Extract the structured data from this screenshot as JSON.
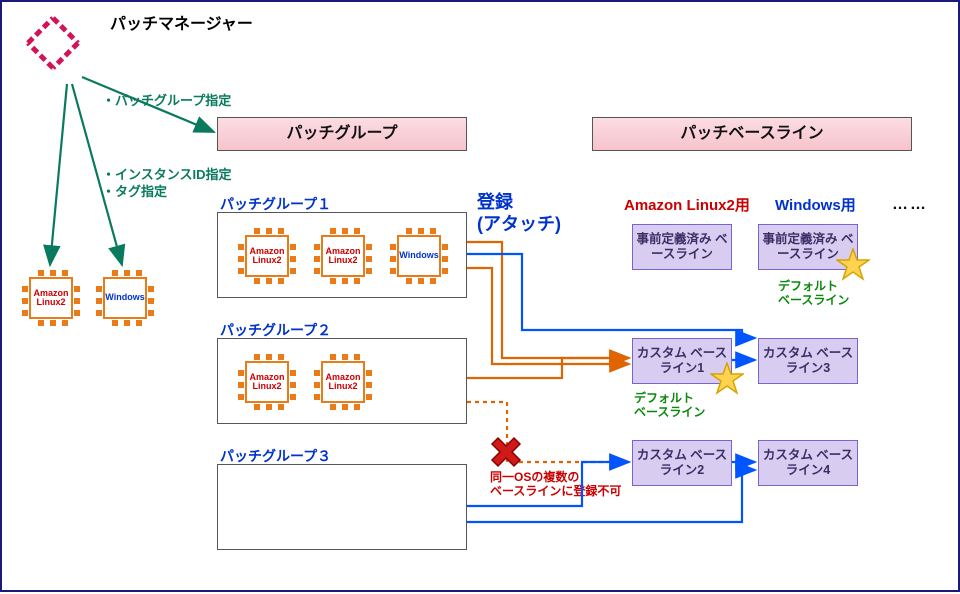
{
  "title": "パッチマネージャー",
  "notes": {
    "patch_group_spec": "・パッチグループ指定",
    "instance_id_spec": "・インスタンスID指定",
    "tag_spec": "・タグ指定",
    "register_attach": "登録\n(アタッチ)",
    "warn_multi_register": "同一OSの複数の\nベースラインに登録不可",
    "default_baseline_1": "デフォルト\nベースライン",
    "default_baseline_2": "デフォルト\nベースライン"
  },
  "headers": {
    "patch_group": "パッチグループ",
    "patch_baseline": "パッチベースライン"
  },
  "columns": {
    "col1": "Amazon Linux2用",
    "col2": "Windows用",
    "more": "……"
  },
  "groups": {
    "g1": "パッチグループ１",
    "g2": "パッチグループ２",
    "g3": "パッチグループ３"
  },
  "chips": {
    "al2": "Amazon\nLinux2",
    "win": "Windows"
  },
  "baselines": {
    "predef": "事前定義済み\nベースライン",
    "c1": "カスタム\nベースライン1",
    "c2": "カスタム\nベースライン2",
    "c3": "カスタム\nベースライン3",
    "c4": "カスタム\nベースライン4"
  }
}
